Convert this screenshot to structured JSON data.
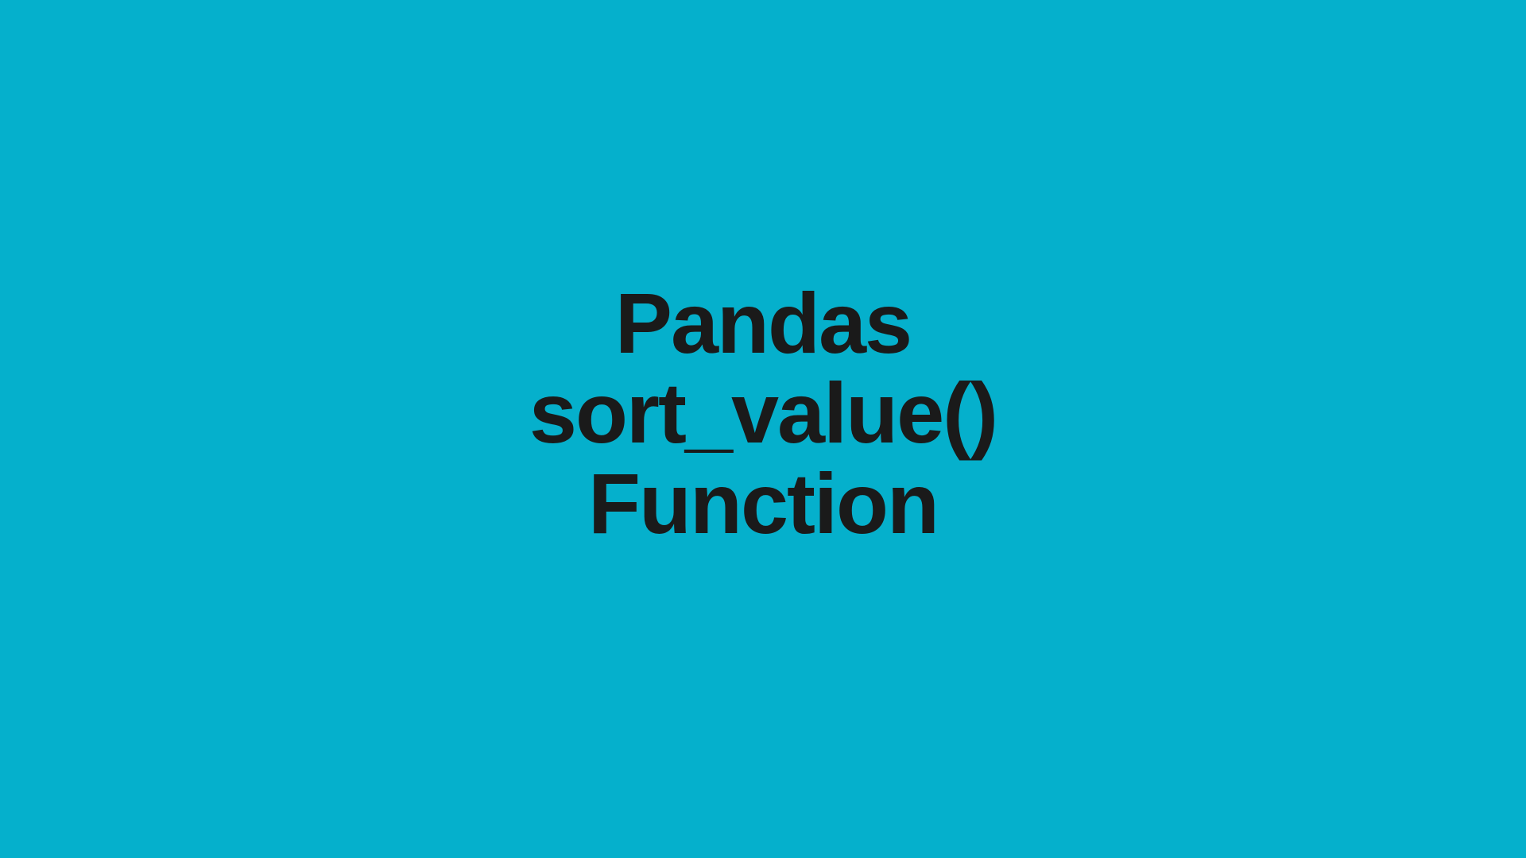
{
  "title": {
    "line1": "Pandas",
    "line2": "sort_value()",
    "line3": "Function"
  },
  "colors": {
    "background": "#05b0cc",
    "text": "#1a1a1a"
  }
}
